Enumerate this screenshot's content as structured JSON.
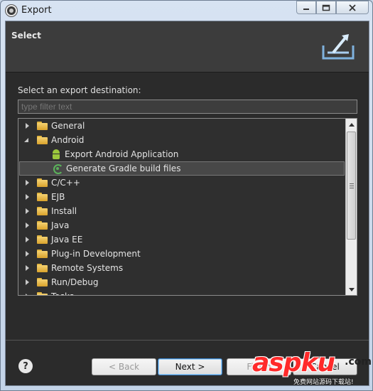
{
  "window": {
    "title": "Export"
  },
  "header": {
    "title": "Select"
  },
  "main": {
    "destination_label": "Select an export destination:",
    "filter_placeholder": "type filter text"
  },
  "tree": [
    {
      "label": "General",
      "type": "folder",
      "state": "closed"
    },
    {
      "label": "Android",
      "type": "folder",
      "state": "open"
    },
    {
      "label": "Export Android Application",
      "type": "android-icon",
      "state": "leaf"
    },
    {
      "label": "Generate Gradle build files",
      "type": "gradle-icon",
      "state": "leaf",
      "selected": true
    },
    {
      "label": "C/C++",
      "type": "folder",
      "state": "closed"
    },
    {
      "label": "EJB",
      "type": "folder",
      "state": "closed"
    },
    {
      "label": "Install",
      "type": "folder",
      "state": "closed"
    },
    {
      "label": "Java",
      "type": "folder",
      "state": "closed"
    },
    {
      "label": "Java EE",
      "type": "folder",
      "state": "closed"
    },
    {
      "label": "Plug-in Development",
      "type": "folder",
      "state": "closed"
    },
    {
      "label": "Remote Systems",
      "type": "folder",
      "state": "closed"
    },
    {
      "label": "Run/Debug",
      "type": "folder",
      "state": "closed"
    },
    {
      "label": "Tasks",
      "type": "folder",
      "state": "closed"
    }
  ],
  "footer": {
    "back_label": "< Back",
    "next_label": "Next >",
    "finish_label": "Finish",
    "cancel_label": "Cancel"
  },
  "watermark": {
    "main": "aspku",
    "sub": ".com",
    "line": "免费网站源码下载站!"
  },
  "colors": {
    "client_bg": "#2b2b2b",
    "header_bg": "#3c3c3c",
    "folder": "#f4d271",
    "accent": "#3a7fc4"
  }
}
